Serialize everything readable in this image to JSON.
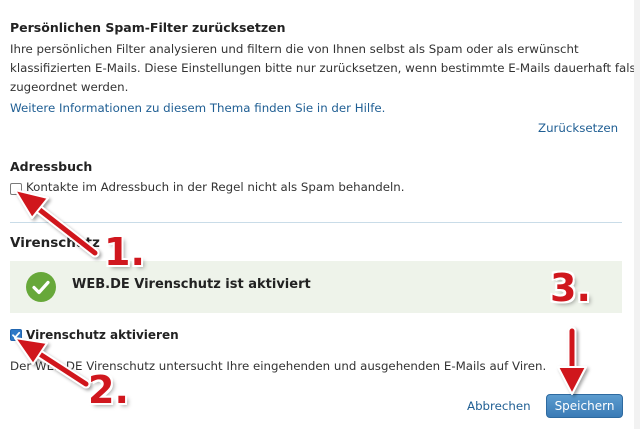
{
  "spam_reset": {
    "heading": "Persönlichen Spam-Filter zurücksetzen",
    "line1": "Ihre persönlichen Filter analysieren und filtern die von Ihnen selbst als Spam oder als erwünscht",
    "line2": "klassifizierten E-Mails. Diese Einstellungen bitte nur zurücksetzen, wenn bestimmte E-Mails dauerhaft falsch",
    "line3": "zugeordnet werden.",
    "help_link": "Weitere Informationen zu diesem Thema finden Sie in der Hilfe.",
    "reset_link": "Zurücksetzen"
  },
  "addressbook": {
    "heading": "Adressbuch",
    "checkbox_label": "Kontakte im Adressbuch in der Regel nicht als Spam behandeln.",
    "checked": false
  },
  "virus": {
    "heading": "Virenschutz",
    "status_text": "WEB.DE Virenschutz ist aktiviert",
    "checkbox_label": "Virenschutz aktivieren",
    "checked": true,
    "description": "Der WEB.DE Virenschutz untersucht Ihre eingehenden und ausgehenden E-Mails auf Viren."
  },
  "actions": {
    "cancel_label": "Abbrechen",
    "save_label": "Speichern"
  },
  "annotations": {
    "step1": "1.",
    "step2": "2.",
    "step3": "3.",
    "color": "#d0171e"
  },
  "colors": {
    "link": "#1f5e93",
    "banner_bg": "#eef3ea",
    "success_green": "#67a83a",
    "save_button": "#3a7bb6"
  }
}
